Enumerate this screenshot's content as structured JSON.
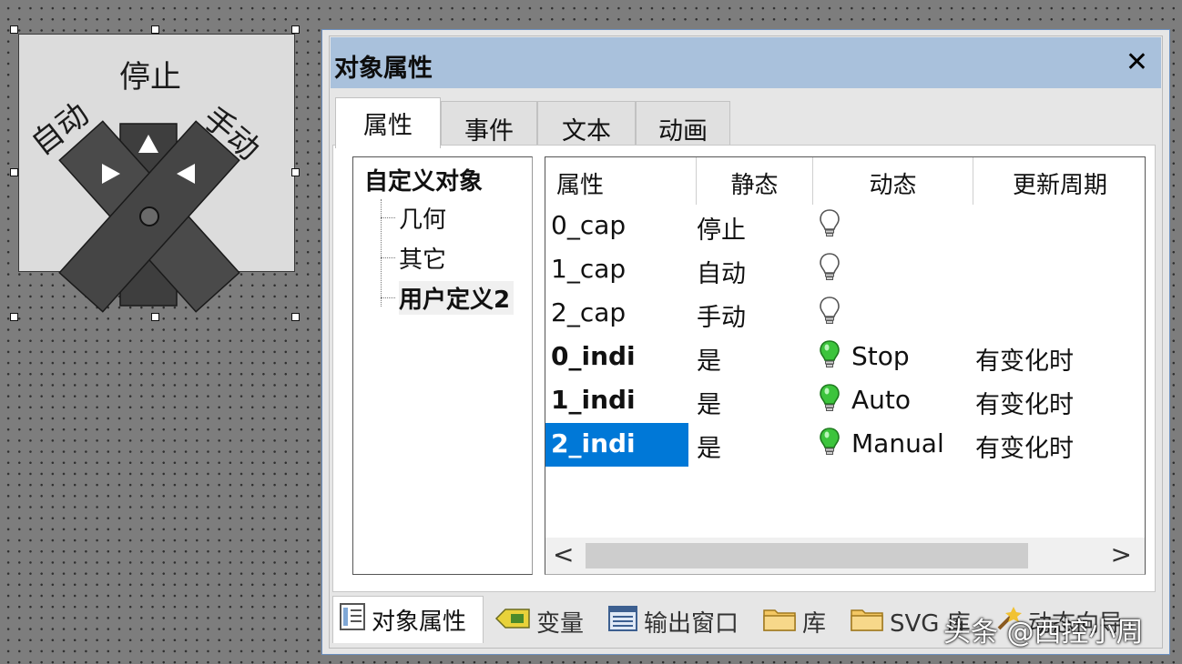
{
  "canvas": {
    "knob_label_top": "停止",
    "knob_label_left": "自动",
    "knob_label_right": "手动"
  },
  "dialog": {
    "title": "对象属性",
    "close_label": "✕",
    "tabs": [
      {
        "label": "属性",
        "active": true
      },
      {
        "label": "事件",
        "active": false
      },
      {
        "label": "文本",
        "active": false
      },
      {
        "label": "动画",
        "active": false
      }
    ],
    "tree": {
      "root": "自定义对象",
      "items": [
        {
          "label": "几何",
          "selected": false
        },
        {
          "label": "其它",
          "selected": false
        },
        {
          "label": "用户定义2",
          "selected": true
        }
      ]
    },
    "grid": {
      "columns": [
        "属性",
        "静态",
        "动态",
        "更新周期"
      ],
      "rows": [
        {
          "property": "0_cap",
          "static": "停止",
          "bulb": "off",
          "dynamic": "",
          "update": "",
          "bold": false,
          "selected": false
        },
        {
          "property": "1_cap",
          "static": "自动",
          "bulb": "off",
          "dynamic": "",
          "update": "",
          "bold": false,
          "selected": false
        },
        {
          "property": "2_cap",
          "static": "手动",
          "bulb": "off",
          "dynamic": "",
          "update": "",
          "bold": false,
          "selected": false
        },
        {
          "property": "0_indi",
          "static": "是",
          "bulb": "on",
          "dynamic": "Stop",
          "update": "有变化时",
          "bold": true,
          "selected": false
        },
        {
          "property": "1_indi",
          "static": "是",
          "bulb": "on",
          "dynamic": "Auto",
          "update": "有变化时",
          "bold": true,
          "selected": false
        },
        {
          "property": "2_indi",
          "static": "是",
          "bulb": "on",
          "dynamic": "Manual",
          "update": "有变化时",
          "bold": true,
          "selected": true
        }
      ],
      "scroll_left": "<",
      "scroll_right": ">"
    },
    "bottom_tabs": [
      {
        "label": "对象属性",
        "icon": "properties-icon",
        "active": true
      },
      {
        "label": "变量",
        "icon": "tag-icon",
        "active": false
      },
      {
        "label": "输出窗口",
        "icon": "output-window-icon",
        "active": false
      },
      {
        "label": "库",
        "icon": "folder-icon",
        "active": false
      },
      {
        "label": "SVG 库",
        "icon": "folder-icon",
        "active": false
      },
      {
        "label": "动态向导",
        "icon": "wizard-icon",
        "active": false
      }
    ]
  },
  "colors": {
    "selection_blue": "#0078d7",
    "title_bar": "#a9c1dc",
    "bulb_on": "#3cc43c"
  },
  "watermark": "头条 @西控小周"
}
